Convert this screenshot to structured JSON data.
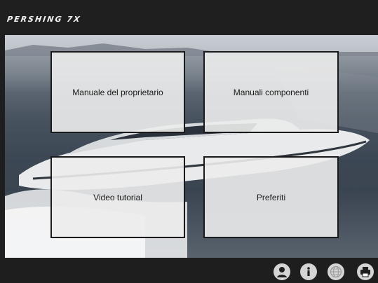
{
  "header": {
    "logo_text": "PERSHING 7X"
  },
  "menu": {
    "tiles": [
      {
        "label": "Manuale del proprietario"
      },
      {
        "label": "Manuali componenti"
      },
      {
        "label": "Video tutorial"
      },
      {
        "label": "Preferiti"
      }
    ]
  },
  "footer": {
    "buttons": [
      {
        "icon": "user-icon"
      },
      {
        "icon": "info-icon"
      },
      {
        "icon": "globe-icon"
      },
      {
        "icon": "printer-icon"
      }
    ]
  },
  "colors": {
    "bar_background": "#1e1e1e",
    "tile_background": "#ececec",
    "icon_color": "#d4d4d4"
  }
}
